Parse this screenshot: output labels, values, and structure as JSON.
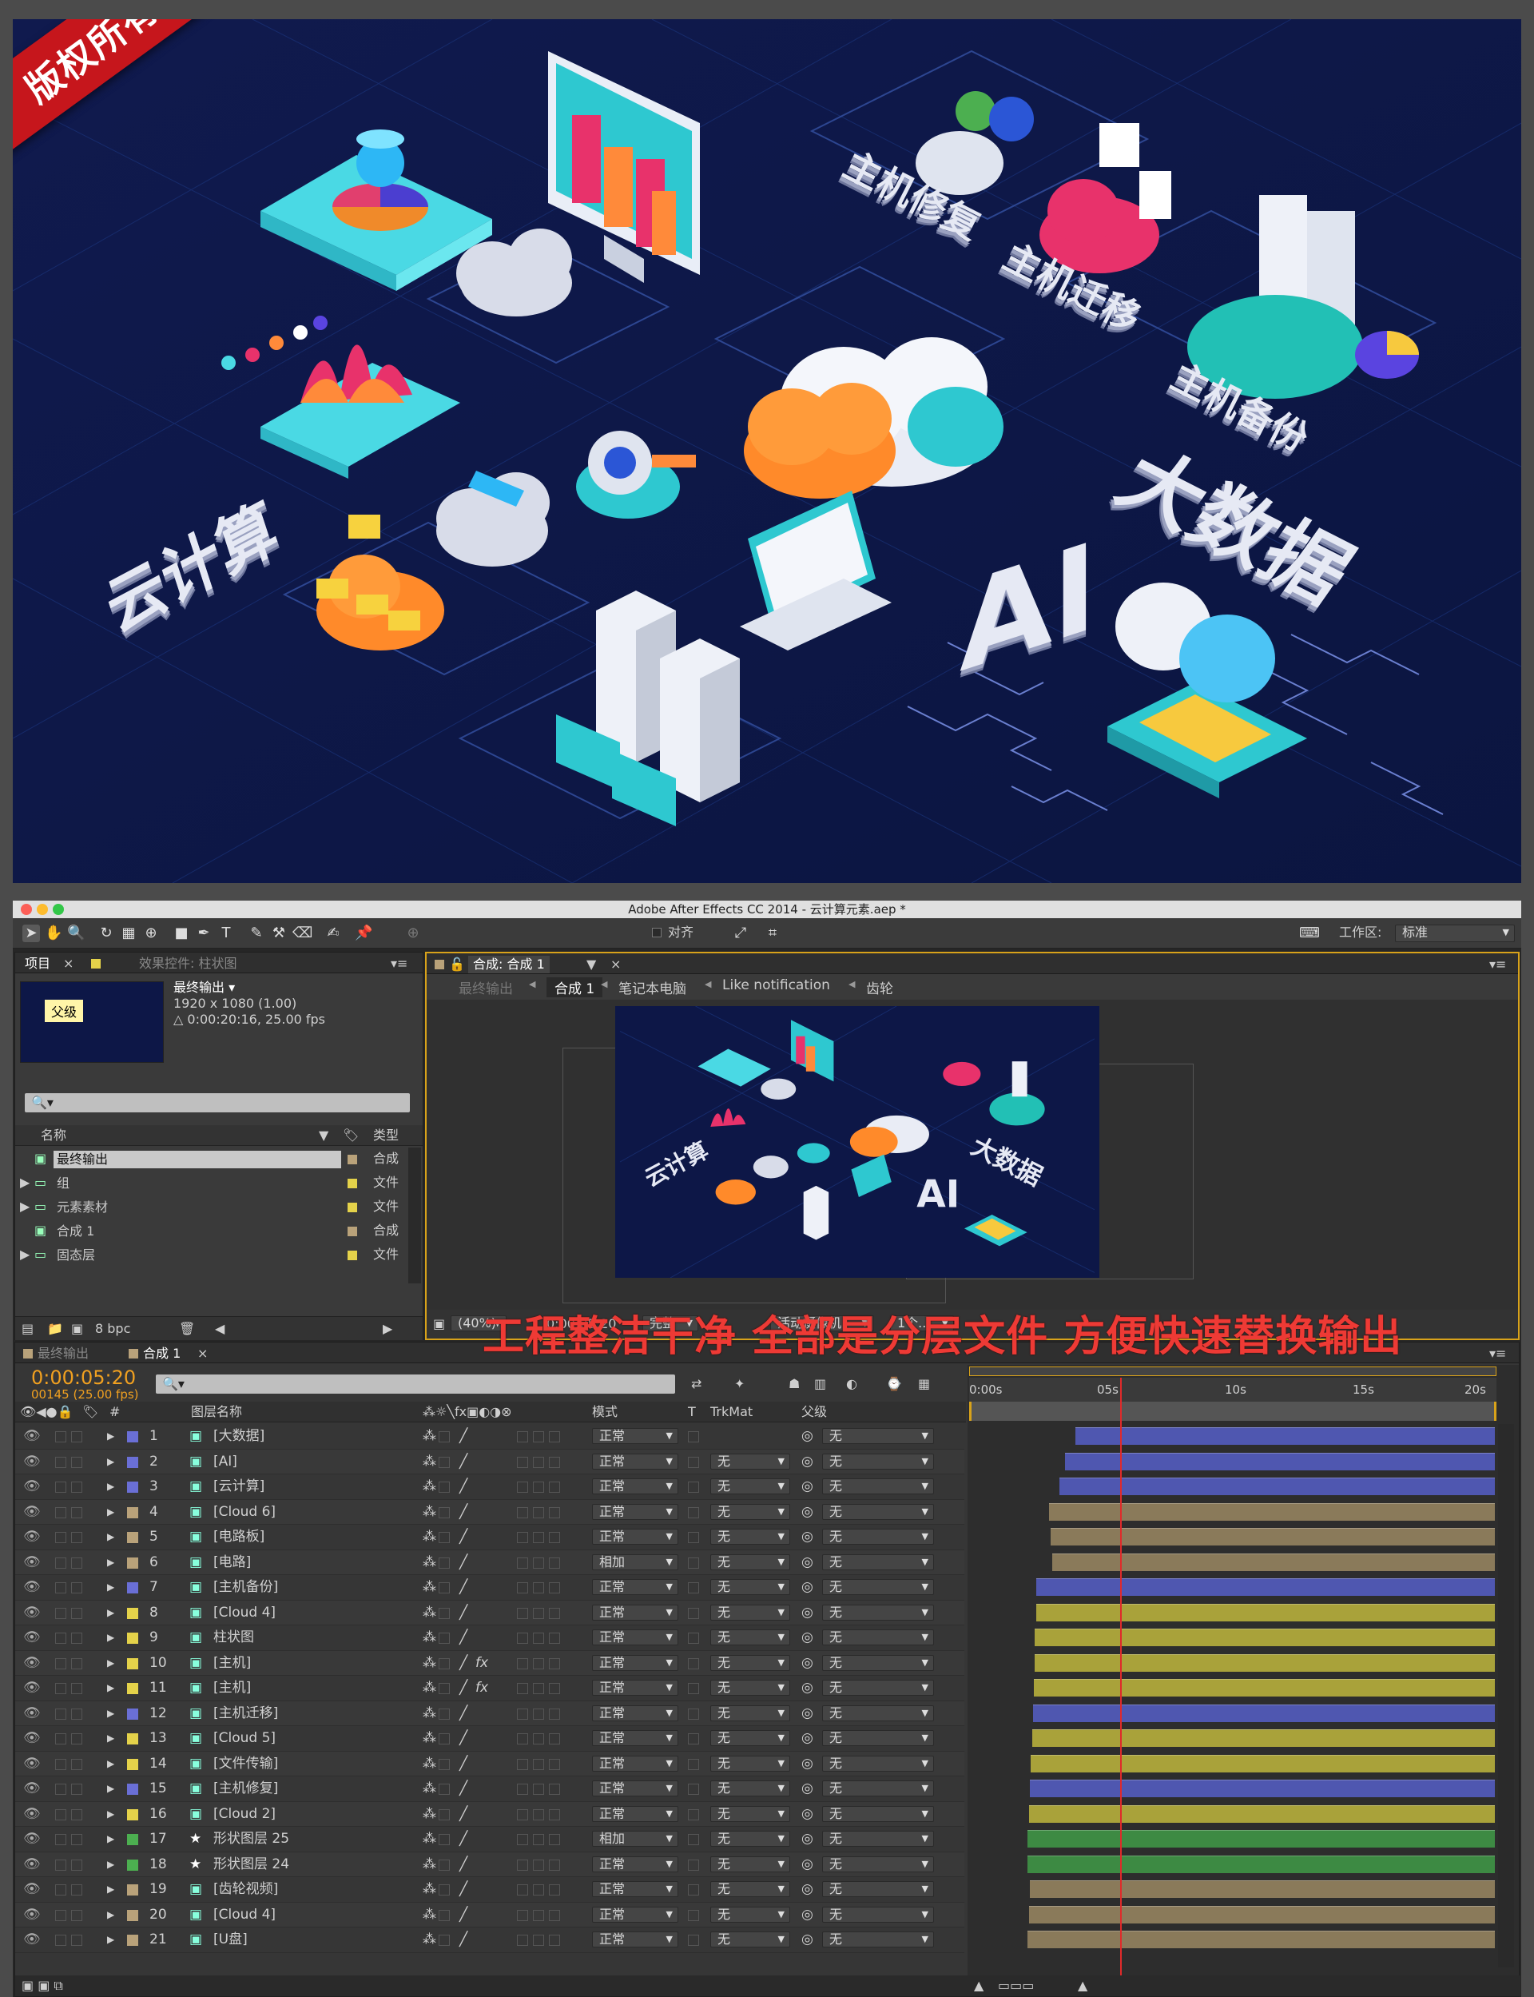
{
  "banner": {
    "text": "版权所有 违者必究"
  },
  "artwork": {
    "labels": {
      "cloud": "云计算",
      "bigdata": "大数据",
      "ai": "AI",
      "repair": "主机修复",
      "migrate": "主机迁移",
      "backup": "主机备份"
    }
  },
  "window": {
    "title": "Adobe After Effects CC 2014 - 云计算元素.aep *"
  },
  "toolbar": {
    "snap_label": "对齐",
    "workspace_label": "工作区:",
    "workspace_value": "标准"
  },
  "project_panel": {
    "tab_project": "项目",
    "tab_effects": "效果控件: 柱状图",
    "thumb_label": "父级",
    "comp_name": "最终输出 ▾",
    "comp_size": "1920 x 1080 (1.00)",
    "comp_duration": "△ 0:00:20:16, 25.00 fps",
    "search_placeholder": "🔍▾",
    "col_name": "名称",
    "col_type": "类型",
    "items": [
      {
        "name": "最终输出",
        "type": "合成",
        "icon": "composition-icon",
        "color": "#b9a27a",
        "selected": true,
        "expandable": false
      },
      {
        "name": "组",
        "type": "文件",
        "icon": "folder-icon",
        "color": "#e4d24a",
        "selected": false,
        "expandable": true
      },
      {
        "name": "元素素材",
        "type": "文件",
        "icon": "folder-icon",
        "color": "#e4d24a",
        "selected": false,
        "expandable": true
      },
      {
        "name": "合成 1",
        "type": "合成",
        "icon": "composition-icon",
        "color": "#b9a27a",
        "selected": false,
        "expandable": false
      },
      {
        "name": "固态层",
        "type": "文件",
        "icon": "folder-icon",
        "color": "#e4d24a",
        "selected": false,
        "expandable": true
      }
    ],
    "bpc": "8 bpc"
  },
  "comp_panel": {
    "tab_label": "合成: 合成 1",
    "breadcrumbs": [
      "最终输出",
      "合成 1",
      "笔记本电脑",
      "Like notification",
      "齿轮"
    ],
    "zoom": "(40%)",
    "timecode": "0:00:05:20",
    "resolution": "完整",
    "camera": "活动摄像机",
    "views": "1个..."
  },
  "overlay_caption": "工程整洁干净 全部是分层文件 方便快速替换输出",
  "timeline": {
    "tab_final": "最终输出",
    "tab_comp": "合成 1",
    "current_time": "0:00:05:20",
    "frame_info": "00145 (25.00 fps)",
    "search_placeholder": "🔍▾",
    "headers": {
      "num": "#",
      "layer_name": "图层名称",
      "mode": "模式",
      "t": "T",
      "trkmat": "TrkMat",
      "parent": "父级"
    },
    "ruler": [
      "0:00s",
      "05s",
      "10s",
      "15s",
      "20s"
    ],
    "layers": [
      {
        "n": "1",
        "name": "[大数据]",
        "label": "#6a6fd6",
        "icon": "comp",
        "mode": "正常",
        "trk": "",
        "parent": "无",
        "fx": false,
        "start": 0.205,
        "barColor": "#4f57b0"
      },
      {
        "n": "2",
        "name": "[AI]",
        "label": "#6a6fd6",
        "icon": "comp",
        "mode": "正常",
        "trk": "无",
        "parent": "无",
        "fx": false,
        "start": 0.185,
        "barColor": "#4f57b0"
      },
      {
        "n": "3",
        "name": "[云计算]",
        "label": "#6a6fd6",
        "icon": "comp",
        "mode": "正常",
        "trk": "无",
        "parent": "无",
        "fx": false,
        "start": 0.175,
        "barColor": "#4f57b0"
      },
      {
        "n": "4",
        "name": "[Cloud 6]",
        "label": "#b9a27a",
        "icon": "comp",
        "mode": "正常",
        "trk": "无",
        "parent": "无",
        "fx": false,
        "start": 0.155,
        "barColor": "#8a7a5a"
      },
      {
        "n": "5",
        "name": "[电路板]",
        "label": "#b9a27a",
        "icon": "comp",
        "mode": "正常",
        "trk": "无",
        "parent": "无",
        "fx": false,
        "start": 0.158,
        "barColor": "#8a7a5a"
      },
      {
        "n": "6",
        "name": "[电路]",
        "label": "#b9a27a",
        "icon": "comp",
        "mode": "相加",
        "trk": "无",
        "parent": "无",
        "fx": false,
        "start": 0.16,
        "barColor": "#8a7a5a"
      },
      {
        "n": "7",
        "name": "[主机备份]",
        "label": "#6a6fd6",
        "icon": "comp",
        "mode": "正常",
        "trk": "无",
        "parent": "无",
        "fx": false,
        "start": 0.13,
        "barColor": "#4f57b0"
      },
      {
        "n": "8",
        "name": "[Cloud 4]",
        "label": "#e4d24a",
        "icon": "comp",
        "mode": "正常",
        "trk": "无",
        "parent": "无",
        "fx": false,
        "start": 0.13,
        "barColor": "#a9a23a"
      },
      {
        "n": "9",
        "name": "柱状图",
        "label": "#e4d24a",
        "icon": "comp",
        "mode": "正常",
        "trk": "无",
        "parent": "无",
        "fx": false,
        "start": 0.128,
        "barColor": "#a9a23a"
      },
      {
        "n": "10",
        "name": "[主机]",
        "label": "#e4d24a",
        "icon": "comp",
        "mode": "正常",
        "trk": "无",
        "parent": "无",
        "fx": true,
        "start": 0.128,
        "barColor": "#a9a23a"
      },
      {
        "n": "11",
        "name": "[主机]",
        "label": "#e4d24a",
        "icon": "comp",
        "mode": "正常",
        "trk": "无",
        "parent": "无",
        "fx": true,
        "start": 0.126,
        "barColor": "#a9a23a"
      },
      {
        "n": "12",
        "name": "[主机迁移]",
        "label": "#6a6fd6",
        "icon": "comp",
        "mode": "正常",
        "trk": "无",
        "parent": "无",
        "fx": false,
        "start": 0.124,
        "barColor": "#4f57b0"
      },
      {
        "n": "13",
        "name": "[Cloud 5]",
        "label": "#e4d24a",
        "icon": "comp",
        "mode": "正常",
        "trk": "无",
        "parent": "无",
        "fx": false,
        "start": 0.122,
        "barColor": "#a9a23a"
      },
      {
        "n": "14",
        "name": "[文件传输]",
        "label": "#e4d24a",
        "icon": "comp",
        "mode": "正常",
        "trk": "无",
        "parent": "无",
        "fx": false,
        "start": 0.12,
        "barColor": "#a9a23a"
      },
      {
        "n": "15",
        "name": "[主机修复]",
        "label": "#6a6fd6",
        "icon": "comp",
        "mode": "正常",
        "trk": "无",
        "parent": "无",
        "fx": false,
        "start": 0.118,
        "barColor": "#4f57b0"
      },
      {
        "n": "16",
        "name": "[Cloud 2]",
        "label": "#e4d24a",
        "icon": "comp",
        "mode": "正常",
        "trk": "无",
        "parent": "无",
        "fx": false,
        "start": 0.116,
        "barColor": "#a9a23a"
      },
      {
        "n": "17",
        "name": "形状图层 25",
        "label": "#4caf50",
        "icon": "star",
        "mode": "相加",
        "trk": "无",
        "parent": "无",
        "fx": false,
        "start": 0.114,
        "barColor": "#3d8a43"
      },
      {
        "n": "18",
        "name": "形状图层 24",
        "label": "#4caf50",
        "icon": "star",
        "mode": "正常",
        "trk": "无",
        "parent": "无",
        "fx": false,
        "start": 0.114,
        "barColor": "#3d8a43"
      },
      {
        "n": "19",
        "name": "[齿轮视频]",
        "label": "#b9a27a",
        "icon": "comp",
        "mode": "正常",
        "trk": "无",
        "parent": "无",
        "fx": false,
        "start": 0.118,
        "barColor": "#8a7a5a"
      },
      {
        "n": "20",
        "name": "[Cloud 4]",
        "label": "#b9a27a",
        "icon": "comp",
        "mode": "正常",
        "trk": "无",
        "parent": "无",
        "fx": false,
        "start": 0.116,
        "barColor": "#8a7a5a"
      },
      {
        "n": "21",
        "name": "[U盘]",
        "label": "#b9a27a",
        "icon": "comp",
        "mode": "正常",
        "trk": "无",
        "parent": "无",
        "fx": false,
        "start": 0.114,
        "barColor": "#8a7a5a"
      }
    ],
    "playhead_fraction": 0.29
  }
}
